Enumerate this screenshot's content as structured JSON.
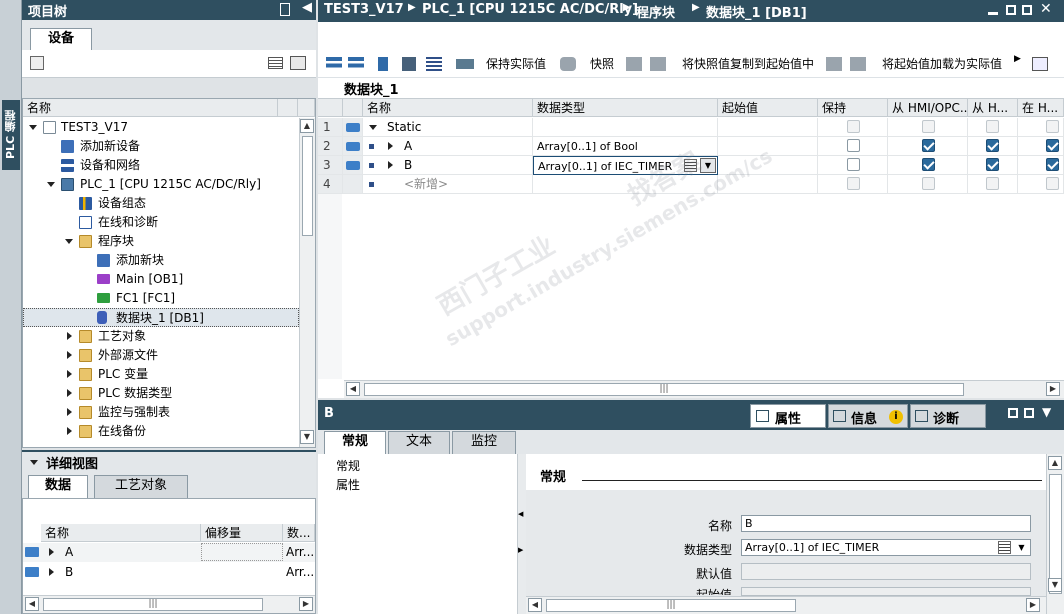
{
  "project_tree": {
    "title": "项目树",
    "tab_device": "设备",
    "col_name": "名称",
    "items": [
      {
        "label": "TEST3_V17"
      },
      {
        "label": "添加新设备"
      },
      {
        "label": "设备和网络"
      },
      {
        "label": "PLC_1 [CPU 1215C AC/DC/Rly]"
      },
      {
        "label": "设备组态"
      },
      {
        "label": "在线和诊断"
      },
      {
        "label": "程序块"
      },
      {
        "label": "添加新块"
      },
      {
        "label": "Main [OB1]"
      },
      {
        "label": "FC1 [FC1]"
      },
      {
        "label": "数据块_1 [DB1]"
      },
      {
        "label": "工艺对象"
      },
      {
        "label": "外部源文件"
      },
      {
        "label": "PLC 变量"
      },
      {
        "label": "PLC 数据类型"
      },
      {
        "label": "监控与强制表"
      },
      {
        "label": "在线备份"
      }
    ]
  },
  "side_tab": "PLC 编程",
  "detail_view": {
    "title": "详细视图",
    "tab_data": "数据",
    "tab_tech": "工艺对象",
    "col_name": "名称",
    "col_offset": "偏移量",
    "col_type": "数...",
    "rows": [
      {
        "name": "A",
        "type": "Arr..."
      },
      {
        "name": "B",
        "type": "Arr..."
      }
    ]
  },
  "breadcrumb": {
    "items": [
      "TEST3_V17",
      "PLC_1 [CPU 1215C AC/DC/Rly]",
      "程序块",
      "数据块_1 [DB1]"
    ]
  },
  "toolbar": {
    "keep_actual": "保持实际值",
    "snapshot": "快照",
    "copy_snapshot": "将快照值复制到起始值中",
    "load_start": "将起始值加载为实际值"
  },
  "editor": {
    "block_title": "数据块_1",
    "columns": [
      "名称",
      "数据类型",
      "起始值",
      "保持",
      "从 HMI/OPC...",
      "从 H...",
      "在 H..."
    ],
    "rows": [
      {
        "num": "1",
        "name": "Static",
        "type": "",
        "keep": false,
        "hmi1": false,
        "hmi2": false,
        "hmi3": false,
        "enabled": false
      },
      {
        "num": "2",
        "name": "A",
        "type": "Array[0..1] of Bool",
        "keep": false,
        "hmi1": true,
        "hmi2": true,
        "hmi3": true,
        "enabled": true
      },
      {
        "num": "3",
        "name": "B",
        "type": "Array[0..1] of IEC_TIMER",
        "keep": false,
        "hmi1": true,
        "hmi2": true,
        "hmi3": true,
        "enabled": true
      },
      {
        "num": "4",
        "name": "<新增>",
        "type": "",
        "keep": false,
        "hmi1": false,
        "hmi2": false,
        "hmi3": false,
        "enabled": false
      }
    ]
  },
  "inspector": {
    "object_name": "B",
    "tab_props": "属性",
    "tab_info": "信息",
    "tab_diag": "诊断",
    "subtab_general": "常规",
    "subtab_text": "文本",
    "subtab_monitor": "监控",
    "nav_general": "常规",
    "nav_props": "属性",
    "section_title": "常规",
    "label_name": "名称",
    "value_name": "B",
    "label_type": "数据类型",
    "value_type": "Array[0..1] of IEC_TIMER",
    "label_default": "默认值",
    "label_start": "起始值"
  },
  "watermark": {
    "line1": "西门子工业",
    "line2": "找答案",
    "line3": "support.industry.siemens.com/cs"
  },
  "colors": {
    "header": "#2f4f60",
    "selection": "#dfe6ec",
    "check": "#2b6a9c"
  }
}
